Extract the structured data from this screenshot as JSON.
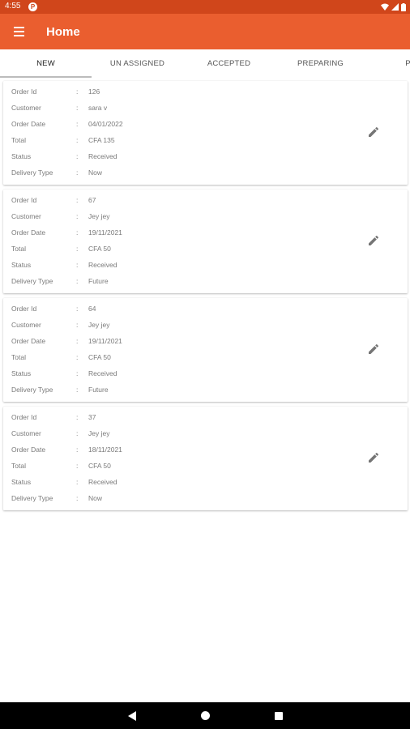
{
  "status_bar": {
    "time": "4:55",
    "notification_glyph": "P"
  },
  "app_bar": {
    "title": "Home"
  },
  "tabs": [
    {
      "label": "NEW",
      "active": true
    },
    {
      "label": "UN ASSIGNED",
      "active": false
    },
    {
      "label": "ACCEPTED",
      "active": false
    },
    {
      "label": "PREPARING",
      "active": false
    },
    {
      "label": "PIC",
      "active": false
    }
  ],
  "field_labels": {
    "order_id": "Order Id",
    "customer": "Customer",
    "order_date": "Order Date",
    "total": "Total",
    "status": "Status",
    "delivery_type": "Delivery Type",
    "separator": ":"
  },
  "orders": [
    {
      "order_id": "126",
      "customer": "sara v",
      "order_date": "04/01/2022",
      "total": "CFA 135",
      "status": "Received",
      "delivery_type": "Now"
    },
    {
      "order_id": "67",
      "customer": "Jey jey",
      "order_date": "19/11/2021",
      "total": "CFA 50",
      "status": "Received",
      "delivery_type": "Future"
    },
    {
      "order_id": "64",
      "customer": "Jey jey",
      "order_date": "19/11/2021",
      "total": "CFA 50",
      "status": "Received",
      "delivery_type": "Future"
    },
    {
      "order_id": "37",
      "customer": "Jey jey",
      "order_date": "18/11/2021",
      "total": "CFA 50",
      "status": "Received",
      "delivery_type": "Now"
    }
  ],
  "icons": {
    "menu": "menu-icon",
    "edit": "pencil-icon",
    "back": "back-triangle-icon",
    "home": "home-circle-icon",
    "recents": "recents-square-icon"
  },
  "colors": {
    "status_bar": "#d0461b",
    "app_bar": "#ea5e2f",
    "tab_indicator": "#bcbcbc",
    "text_secondary": "#7a7a7a"
  }
}
